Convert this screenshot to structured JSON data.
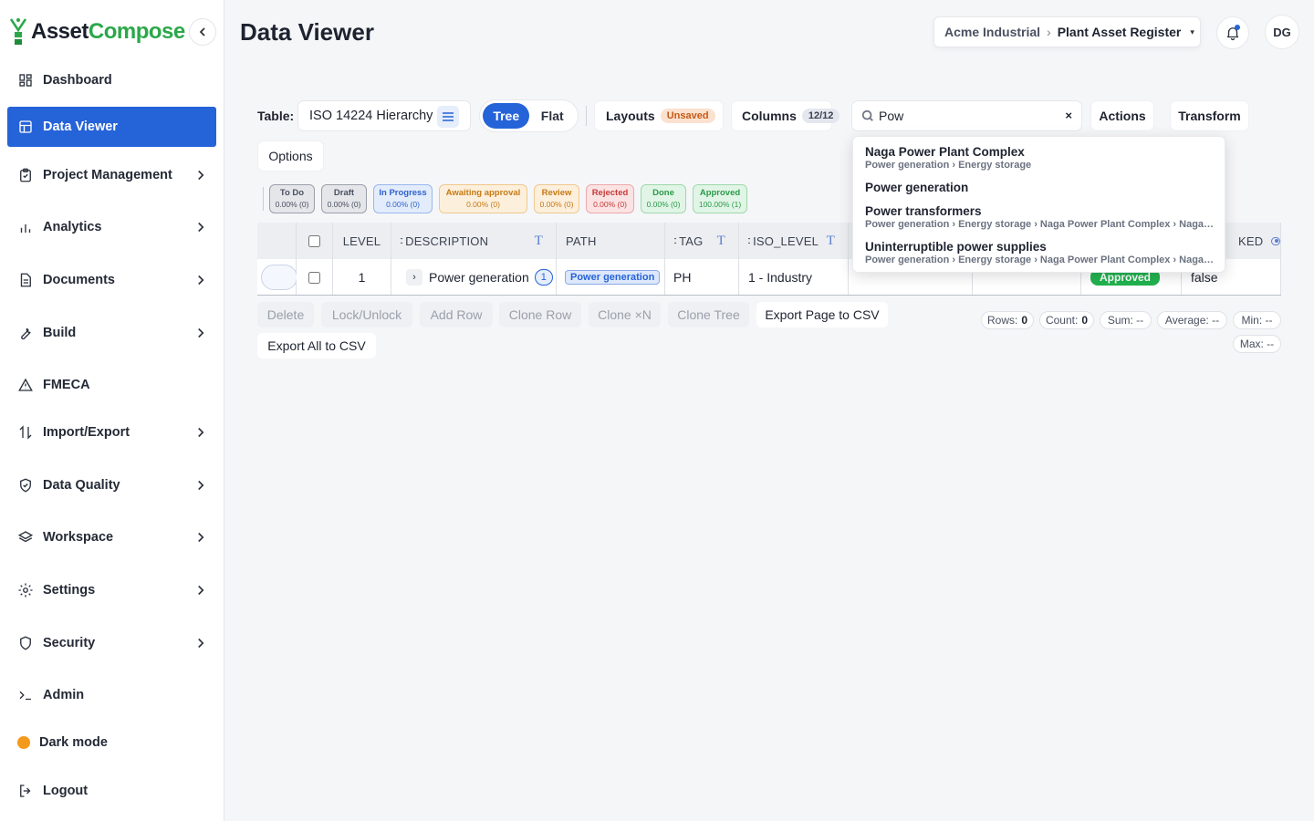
{
  "app": {
    "name_part1": "Asset",
    "name_part2": "Compose",
    "brand_color": "#2aa84a",
    "accent_color": "#2563d8"
  },
  "sidebar": {
    "items": [
      {
        "label": "Dashboard",
        "icon": "dashboard-icon",
        "has_chevron": false,
        "active": false
      },
      {
        "label": "Data Viewer",
        "icon": "table-icon",
        "has_chevron": false,
        "active": true
      },
      {
        "label": "Project Management",
        "icon": "clipboard-icon",
        "has_chevron": true,
        "active": false
      },
      {
        "label": "Analytics",
        "icon": "bar-chart-icon",
        "has_chevron": true,
        "active": false
      },
      {
        "label": "Documents",
        "icon": "document-icon",
        "has_chevron": true,
        "active": false
      },
      {
        "label": "Build",
        "icon": "wrench-icon",
        "has_chevron": true,
        "active": false
      },
      {
        "label": "FMECA",
        "icon": "warning-icon",
        "has_chevron": false,
        "active": false
      },
      {
        "label": "Import/Export",
        "icon": "arrows-updown-icon",
        "has_chevron": true,
        "active": false
      },
      {
        "label": "Data Quality",
        "icon": "shield-check-icon",
        "has_chevron": true,
        "active": false
      },
      {
        "label": "Workspace",
        "icon": "layers-icon",
        "has_chevron": true,
        "active": false
      },
      {
        "label": "Settings",
        "icon": "gear-icon",
        "has_chevron": true,
        "active": false
      },
      {
        "label": "Security",
        "icon": "shield-icon",
        "has_chevron": true,
        "active": false
      },
      {
        "label": "Admin",
        "icon": "terminal-icon",
        "has_chevron": false,
        "active": false
      }
    ],
    "dark_mode_label": "Dark mode",
    "logout_label": "Logout"
  },
  "header": {
    "title": "Data Viewer",
    "org": "Acme Industrial",
    "breadcrumb_sep": "›",
    "register": "Plant Asset Register",
    "avatar_initials": "DG"
  },
  "toolbar": {
    "table_label": "Table:",
    "table_value": "ISO 14224 Hierarchy",
    "view_tree": "Tree",
    "view_flat": "Flat",
    "layouts_label": "Layouts",
    "layouts_badge": "Unsaved",
    "columns_label": "Columns",
    "columns_badge": "12/12",
    "search_value": "Pow",
    "search_clear": "×",
    "actions_label": "Actions",
    "transform_label": "Transform",
    "options_label": "Options"
  },
  "status_chips": [
    {
      "label": "To Do",
      "value": "0.00% (0)",
      "bg": "#e4e6ea",
      "border": "#9aa0aa",
      "color": "#4a5060"
    },
    {
      "label": "Draft",
      "value": "0.00% (0)",
      "bg": "#e4e6ea",
      "border": "#9aa0aa",
      "color": "#4a5060"
    },
    {
      "label": "In Progress",
      "value": "0.00% (0)",
      "bg": "#e3ecfb",
      "border": "#9bb7ee",
      "color": "#2f63c9"
    },
    {
      "label": "Awaiting approval",
      "value": "0.00% (0)",
      "bg": "#fcefdc",
      "border": "#f0c98f",
      "color": "#c57a14"
    },
    {
      "label": "Review",
      "value": "0.00% (0)",
      "bg": "#fcefdc",
      "border": "#f0c98f",
      "color": "#c57a14"
    },
    {
      "label": "Rejected",
      "value": "0.00% (0)",
      "bg": "#fbe3e3",
      "border": "#eba9a9",
      "color": "#c73a3a"
    },
    {
      "label": "Done",
      "value": "0.00% (0)",
      "bg": "#e1f5e6",
      "border": "#9fd8ac",
      "color": "#2a9a4a"
    },
    {
      "label": "Approved",
      "value": "100.00% (1)",
      "bg": "#e1f5e6",
      "border": "#9fd8ac",
      "color": "#2a9a4a"
    }
  ],
  "grid": {
    "columns": [
      "LEVEL",
      "DESCRIPTION",
      "PATH",
      "TAG",
      "ISO_LEVEL",
      "KED"
    ],
    "drag_glyph": "::",
    "filter_glyph": "T",
    "row": {
      "level": "1",
      "description": "Power generation",
      "child_count": "1",
      "path": "Power generation",
      "tag": "PH",
      "iso_level": "1 - Industry",
      "status": "Approved",
      "locked": "false"
    }
  },
  "row_actions": {
    "delete": "Delete",
    "lock": "Lock/Unlock",
    "add_row": "Add Row",
    "clone_row": "Clone Row",
    "clone_n": "Clone ×N",
    "clone_tree": "Clone Tree",
    "export_page": "Export Page to CSV",
    "export_all": "Export All to CSV"
  },
  "stats": {
    "rows_label": "Rows:",
    "rows_value": "0",
    "count_label": "Count:",
    "count_value": "0",
    "sum": "Sum: --",
    "average": "Average: --",
    "min": "Min: --",
    "max": "Max: --"
  },
  "search_results": [
    {
      "title": "Naga Power Plant Complex",
      "path": "Power generation › Energy storage"
    },
    {
      "title": "Power generation",
      "path": ""
    },
    {
      "title": "Power transformers",
      "path": "Power generation › Energy storage › Naga Power Plant Complex › Naga Power Plant Complex"
    },
    {
      "title": "Uninterruptible power supplies",
      "path": "Power generation › Energy storage › Naga Power Plant Complex › Naga Power Plant Complex"
    }
  ]
}
